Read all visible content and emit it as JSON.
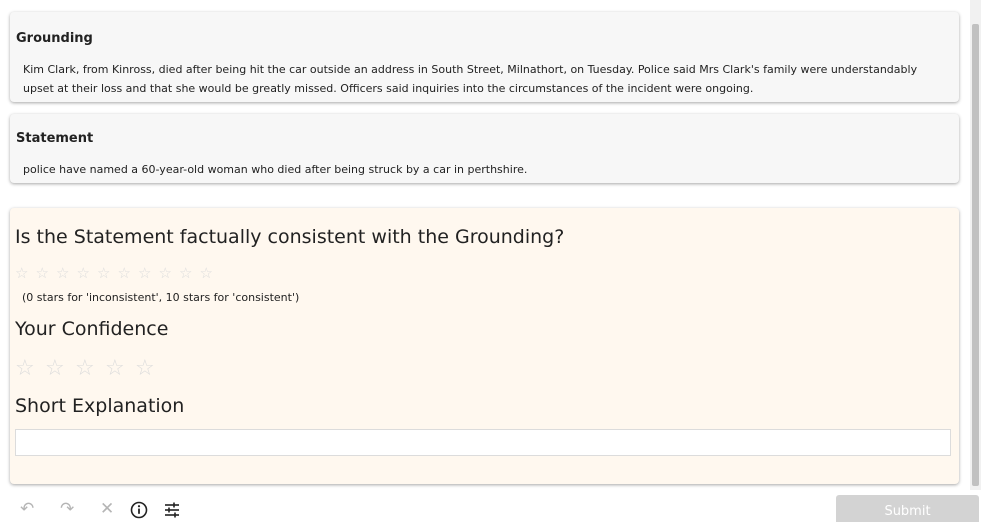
{
  "grounding": {
    "title": "Grounding",
    "text": "Kim Clark, from Kinross, died after being hit the car outside an address in South Street, Milnathort, on Tuesday. Police said Mrs Clark's family were understandably upset at their loss and that she would be greatly missed. Officers said inquiries into the circumstances of the incident were ongoing."
  },
  "statement": {
    "title": "Statement",
    "text": "police have named a 60-year-old woman who died after being struck by a car in perthshire."
  },
  "question": {
    "title": "Is the Statement factually consistent with the Grounding?",
    "rating": 0,
    "max_rating": 10,
    "hint": "(0 stars for 'inconsistent', 10 stars for 'consistent')"
  },
  "confidence": {
    "title": "Your Confidence",
    "rating": 0,
    "max_rating": 5
  },
  "explanation": {
    "title": "Short Explanation",
    "value": "",
    "placeholder": ""
  },
  "toolbar": {
    "icons": [
      "undo-icon",
      "redo-icon",
      "close-icon",
      "info-icon",
      "settings-icon"
    ],
    "submit_label": "Submit"
  },
  "colors": {
    "panel_background": "#fff8ef",
    "card_background": "#f7f7f7",
    "star_empty": "#dcdcdc",
    "submit_disabled": "#d3d3d3"
  }
}
